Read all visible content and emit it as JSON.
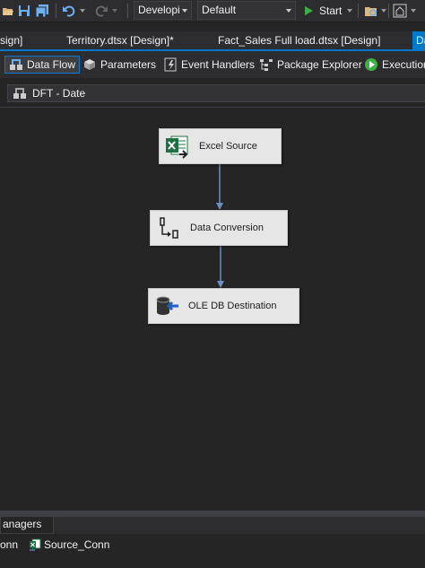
{
  "toolbar": {
    "solution_config": "Developi",
    "platform": "Default",
    "start_label": "Start"
  },
  "document_tabs": [
    {
      "label": "sign]"
    },
    {
      "label": "Territory.dtsx [Design]*"
    },
    {
      "label": "Fact_Sales Full load.dtsx [Design]"
    },
    {
      "label": "Da"
    }
  ],
  "designer_tabs": [
    {
      "label": "Data Flow"
    },
    {
      "label": "Parameters"
    },
    {
      "label": "Event Handlers"
    },
    {
      "label": "Package Explorer"
    },
    {
      "label": "Execution"
    }
  ],
  "data_flow_task": "DFT - Date",
  "components": [
    {
      "label": "Excel Source",
      "icon": "excel-icon"
    },
    {
      "label": "Data Conversion",
      "icon": "data-conversion-icon"
    },
    {
      "label": "OLE DB Destination",
      "icon": "oledb-destination-icon"
    }
  ],
  "connection_managers": {
    "tab_label": "anagers",
    "items": [
      {
        "label": "onn"
      },
      {
        "label": "Source_Conn"
      }
    ]
  },
  "colors": {
    "accent": "#007acc",
    "background": "#252526",
    "component_fill": "#e6e6e6",
    "path_arrow": "#6a8fc0"
  }
}
